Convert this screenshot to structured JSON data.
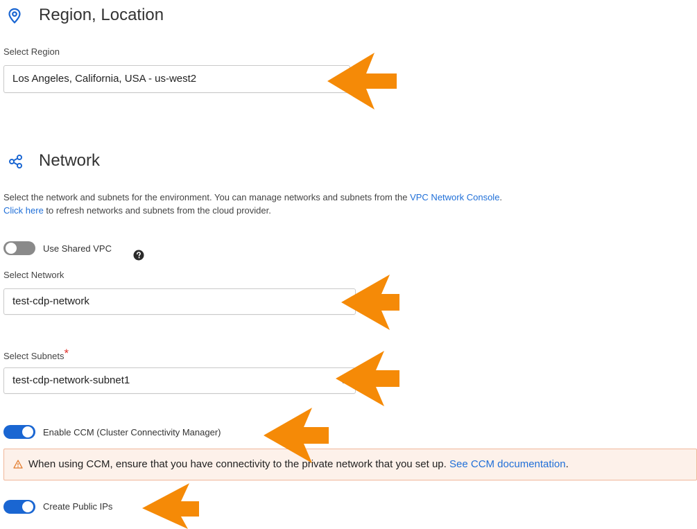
{
  "region_section": {
    "title": "Region, Location",
    "select_label": "Select Region",
    "select_value": "Los Angeles, California, USA - us-west2"
  },
  "network_section": {
    "title": "Network",
    "description_prefix": "Select the network and subnets for the environment. You can manage networks and subnets from the ",
    "console_link": "VPC Network Console",
    "description_suffix": ".",
    "refresh_link": "Click here",
    "refresh_text": " to refresh networks and subnets from the cloud provider.",
    "shared_vpc_label": "Use Shared VPC",
    "network_label": "Select Network",
    "network_value": "test-cdp-network",
    "subnets_label": "Select Subnets",
    "subnets_required": "*",
    "subnets_value": "test-cdp-network-subnet1",
    "ccm_label": "Enable CCM (Cluster Connectivity Manager)",
    "alert_text": "When using CCM, ensure that you have connectivity to the private network that you set up. ",
    "alert_link": "See CCM documentation",
    "alert_suffix": ".",
    "public_ip_label": "Create Public IPs"
  },
  "toggles": {
    "shared_vpc": false,
    "ccm": true,
    "public_ips": true
  },
  "colors": {
    "accent": "#1a66d2",
    "arrow": "#f58a07",
    "alert_bg": "#fdf1ea",
    "required": "#e0322b"
  },
  "icons": {
    "region": "location-pin-icon",
    "network": "share-network-icon",
    "help": "question-circle-icon",
    "warning": "warning-triangle-icon",
    "dropdown": "chevron-down-icon",
    "annotation": "arrow-left-icon"
  }
}
